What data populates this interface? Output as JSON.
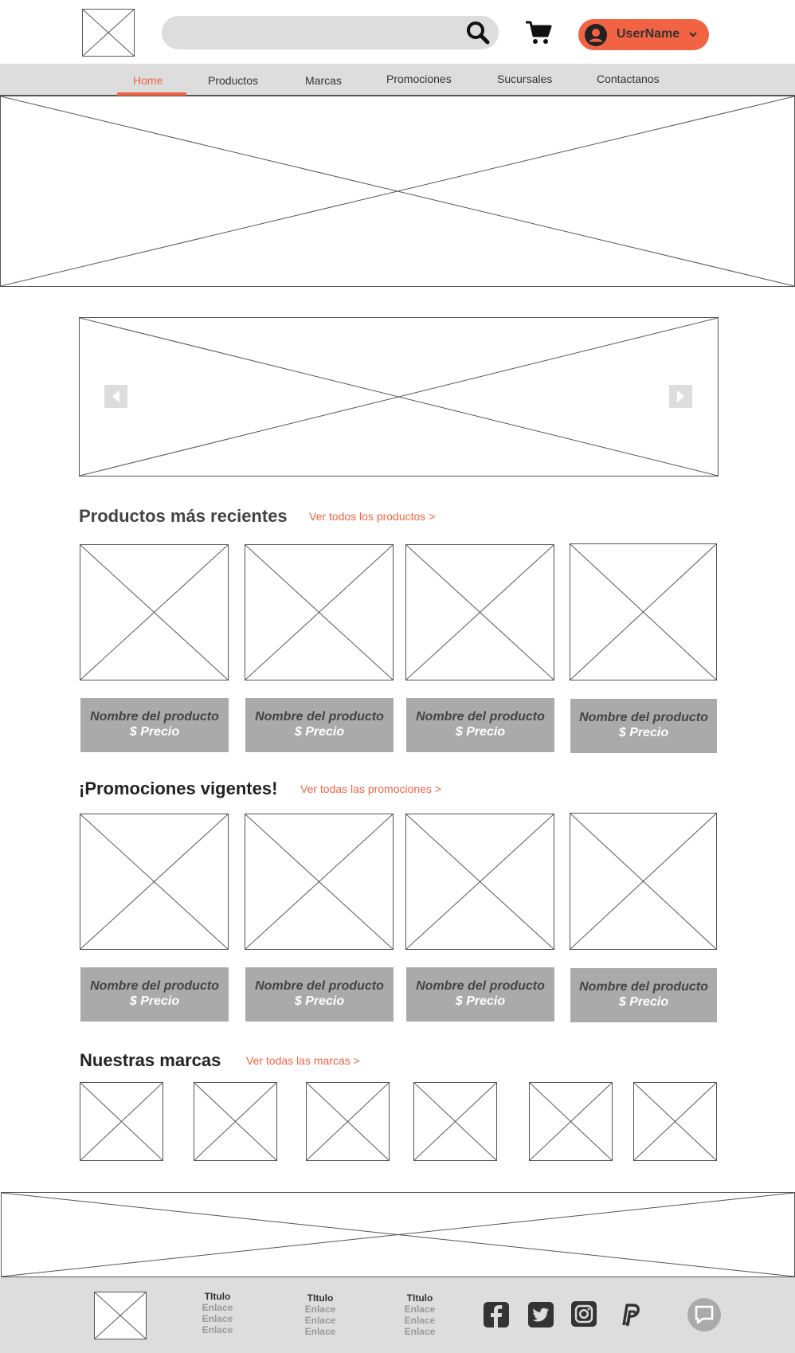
{
  "header": {
    "search_placeholder": "",
    "user_name": "UserName",
    "accent_color": "#f26344"
  },
  "nav": {
    "items": [
      "Home",
      "Productos",
      "Marcas",
      "Promociones",
      "Sucursales",
      "Contactanos"
    ],
    "active": "Home"
  },
  "recent": {
    "title": "Productos más recientes",
    "link": "Ver todos los productos >",
    "cards": [
      {
        "name": "Nombre del producto",
        "price": "$ Precio"
      },
      {
        "name": "Nombre del producto",
        "price": "$ Precio"
      },
      {
        "name": "Nombre del producto",
        "price": "$ Precio"
      },
      {
        "name": "Nombre del producto",
        "price": "$ Precio"
      }
    ]
  },
  "promos": {
    "title": "¡Promociones vigentes!",
    "link": "Ver todas las promociones >",
    "cards": [
      {
        "name": "Nombre del producto",
        "price": "$ Precio"
      },
      {
        "name": "Nombre del producto",
        "price": "$ Precio"
      },
      {
        "name": "Nombre del producto",
        "price": "$ Precio"
      },
      {
        "name": "Nombre del producto",
        "price": "$ Precio"
      }
    ]
  },
  "brands": {
    "title": "Nuestras marcas",
    "link": "Ver todas las marcas >"
  },
  "footer": {
    "columns": [
      {
        "title": "TItulo",
        "links": [
          "Enlace",
          "Enlace",
          "Enlace"
        ]
      },
      {
        "title": "TItulo",
        "links": [
          "Enlace",
          "Enlace",
          "Enlace"
        ]
      },
      {
        "title": "TItulo",
        "links": [
          "Enlace",
          "Enlace",
          "Enlace"
        ]
      }
    ],
    "social_icons": [
      "facebook-icon",
      "twitter-icon",
      "instagram-icon",
      "paypal-icon"
    ],
    "chat_icon": "chat-icon"
  }
}
